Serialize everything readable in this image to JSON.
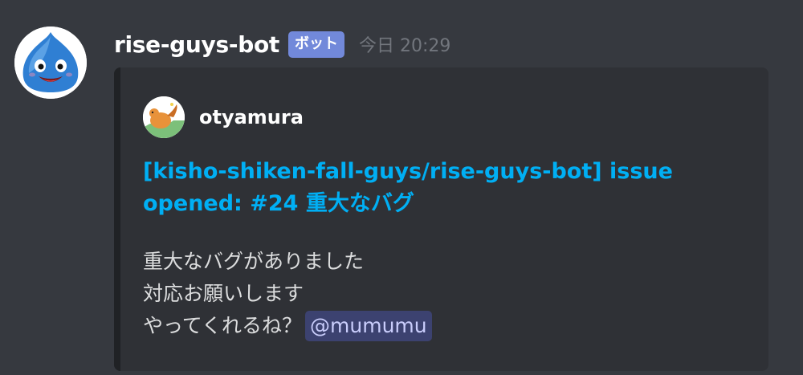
{
  "message": {
    "author": "rise-guys-bot",
    "bot_tag": "ボット",
    "timestamp": "今日 20:29",
    "avatar_icon": "slime-icon"
  },
  "embed": {
    "author": {
      "name": "otyamura",
      "icon": "author-avatar-icon"
    },
    "title": "[kisho-shiken-fall-guys/rise-guys-bot] issue opened: #24 重大なバグ",
    "description": {
      "line1": "重大なバグがありました",
      "line2": "対応お願いします",
      "line3": "やってくれるね？",
      "mention": "@mumumu"
    },
    "colors": {
      "title": "#00aff4",
      "mention_bg": "#3c4270",
      "bot_tag": "#7289da"
    }
  }
}
